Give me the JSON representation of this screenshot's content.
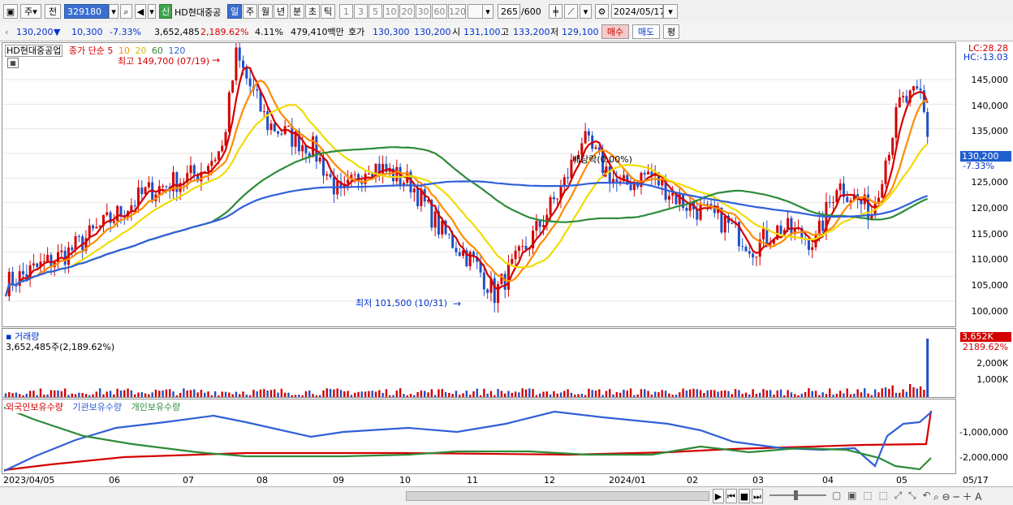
{
  "toolbar": {
    "market": "주",
    "prev": "전",
    "code": "329180",
    "new_badge": "신",
    "stock_name": "HD현대중공",
    "periods": [
      "일",
      "주",
      "월",
      "년",
      "분",
      "초",
      "틱"
    ],
    "intervals": [
      "1",
      "3",
      "5",
      "10",
      "20",
      "30",
      "60",
      "120"
    ],
    "count": "265",
    "count_total": "/600",
    "date": "2024/05/17"
  },
  "quote": {
    "price": "130,200",
    "change": "▼",
    "change_value": "10,300",
    "change_pct": "-7.33%",
    "volume": "3,652,485",
    "volume_pct": "2,189.62%",
    "turnover": "4.11%",
    "amount": "479,410백만",
    "ask_label": "호가",
    "ask1": "130,300",
    "ask2": "130,200",
    "open_label": "시",
    "open": "131,100",
    "high_label": "고",
    "high": "133,200",
    "low_label": "저",
    "low": "129,100",
    "buy_label": "매수",
    "sell_label": "매도",
    "eval_label": "평"
  },
  "price_panel": {
    "name": "HD현대중공업",
    "ma_label": "종가 단순",
    "ma_periods": [
      "5",
      "10",
      "20",
      "60",
      "120"
    ],
    "ma_colors": [
      "#d40000",
      "#ff8c00",
      "#e8d200",
      "#2e8b3a",
      "#3060d8"
    ],
    "max_label": "최고 149,700 (07/19)",
    "min_label": "최저 101,500 (10/31)",
    "dividend_label": "배당락(0.00%)",
    "lc": "LC:28.28",
    "hc": "HC:-13.03",
    "current_price": "130,200",
    "current_pct": "-7.33%",
    "y_ticks": [
      "145,000",
      "140,000",
      "135,000",
      "130,000",
      "125,000",
      "120,000",
      "115,000",
      "110,000",
      "105,000",
      "100,000"
    ]
  },
  "volume_panel": {
    "title": "거래량",
    "value": "3,652,485주(2,189.62%)",
    "current": "3,652K",
    "current_pct": "2189.62%",
    "y_ticks": [
      "2,000K",
      "1,000K"
    ]
  },
  "holdings_panel": {
    "legend": [
      "외국인보유수량",
      "기관보유수량",
      "개인보유수량"
    ],
    "colors": [
      "#d40000",
      "#3060d8",
      "#2e8b3a"
    ],
    "y_ticks": [
      "-1,000,000",
      "-2,000,000"
    ]
  },
  "x_axis": {
    "labels": [
      "2023/04/05",
      "06",
      "07",
      "08",
      "09",
      "10",
      "11",
      "12",
      "2024/01",
      "02",
      "03",
      "04",
      "05",
      "05/17"
    ]
  }
}
